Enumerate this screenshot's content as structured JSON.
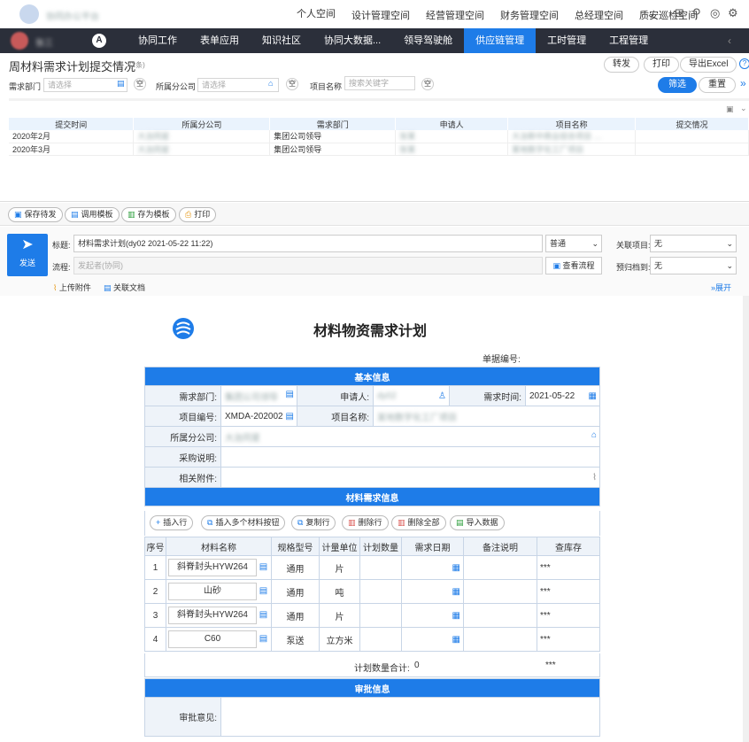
{
  "topbar": {
    "app_name": "协同办公平台",
    "nav": [
      "个人空间",
      "设计管理空间",
      "经营管理空间",
      "财务管理空间",
      "总经理空间",
      "质安巡检空间"
    ],
    "active": 0
  },
  "darknav": {
    "user": "张三",
    "items": [
      "协同工作",
      "表单应用",
      "知识社区",
      "协同大数据...",
      "领导驾驶舱",
      "供应链管理",
      "工时管理",
      "工程管理"
    ],
    "active": 5
  },
  "report": {
    "title": "周材料需求计划提交情况",
    "count": "(2条)",
    "btn_forward": "转发",
    "btn_print": "打印",
    "btn_export": "导出Excel",
    "filter_dept_label": "需求部门",
    "filter_dept_ph": "请选择",
    "filter_company_label": "所属分公司",
    "filter_company_ph": "请选择",
    "filter_project_label": "项目名称",
    "filter_project_ph": "搜索关键字",
    "kong": "空",
    "btn_filter": "筛选",
    "btn_reset": "重置",
    "columns": [
      "提交时间",
      "所属分公司",
      "需求部门",
      "申请人",
      "项目名称",
      "提交情况"
    ],
    "rows": [
      [
        "2020年2月",
        "大治同星",
        "集团公司领导",
        "张某",
        "大冶新中商业综合项目 …",
        ""
      ],
      [
        "2020年3月",
        "大治同星",
        "集团公司领导",
        "张某",
        "某地数字化工厂项目",
        ""
      ]
    ]
  },
  "toolbar": {
    "save": "保存待发",
    "template": "调用模板",
    "save_template": "存为模板",
    "print": "打印"
  },
  "header": {
    "send": "发送",
    "title_label": "标题:",
    "title_value": "材料需求计划(dy02 2021-05-22 11:22)",
    "priority": "普通",
    "related_label": "关联项目:",
    "related_value": "无",
    "flow_label": "流程:",
    "flow_ph": "发起者(协同)",
    "view_flow": "查看流程",
    "archive_label": "预归档到:",
    "archive_value": "无",
    "upload": "上传附件",
    "related_doc": "关联文档",
    "expand": "展开"
  },
  "form": {
    "title": "材料物资需求计划",
    "doc_no_label": "单据编号:",
    "basic_section": "基本信息",
    "dept_label": "需求部门:",
    "dept_value": "集团公司领导",
    "applicant_label": "申请人:",
    "applicant_value": "dy02",
    "date_label": "需求时间:",
    "date_value": "2021-05-22",
    "proj_no_label": "项目编号:",
    "proj_no_value": "XMDA-202002",
    "proj_name_label": "项目名称:",
    "proj_name_value": "某地数字化工厂项目",
    "company_label": "所属分公司:",
    "company_value": "大治同星",
    "purchase_label": "采购说明:",
    "attach_label": "相关附件:",
    "material_section": "材料需求信息",
    "btn_add_row": "插入行",
    "btn_add_multi": "插入多个材料按钮",
    "btn_copy_row": "复制行",
    "btn_delete_row": "删除行",
    "btn_delete_all": "删除全部",
    "btn_import": "导入数据",
    "columns": [
      "序号",
      "材料名称",
      "规格型号",
      "计量单位",
      "计划数量",
      "需求日期",
      "备注说明",
      "查库存"
    ],
    "rows": [
      {
        "no": "1",
        "name": "斜脊封头HYW264",
        "spec": "通用",
        "unit": "片",
        "stock": "***"
      },
      {
        "no": "2",
        "name": "山砂",
        "spec": "通用",
        "unit": "吨",
        "stock": "***"
      },
      {
        "no": "3",
        "name": "斜脊封头HYW264",
        "spec": "通用",
        "unit": "片",
        "stock": "***"
      },
      {
        "no": "4",
        "name": "C60",
        "spec": "泵送",
        "unit": "立方米",
        "stock": "***"
      }
    ],
    "total_label": "计划数量合计:",
    "total_value": "0",
    "total_stock": "***",
    "approval_section": "审批信息",
    "opinion_label": "审批意见:"
  }
}
